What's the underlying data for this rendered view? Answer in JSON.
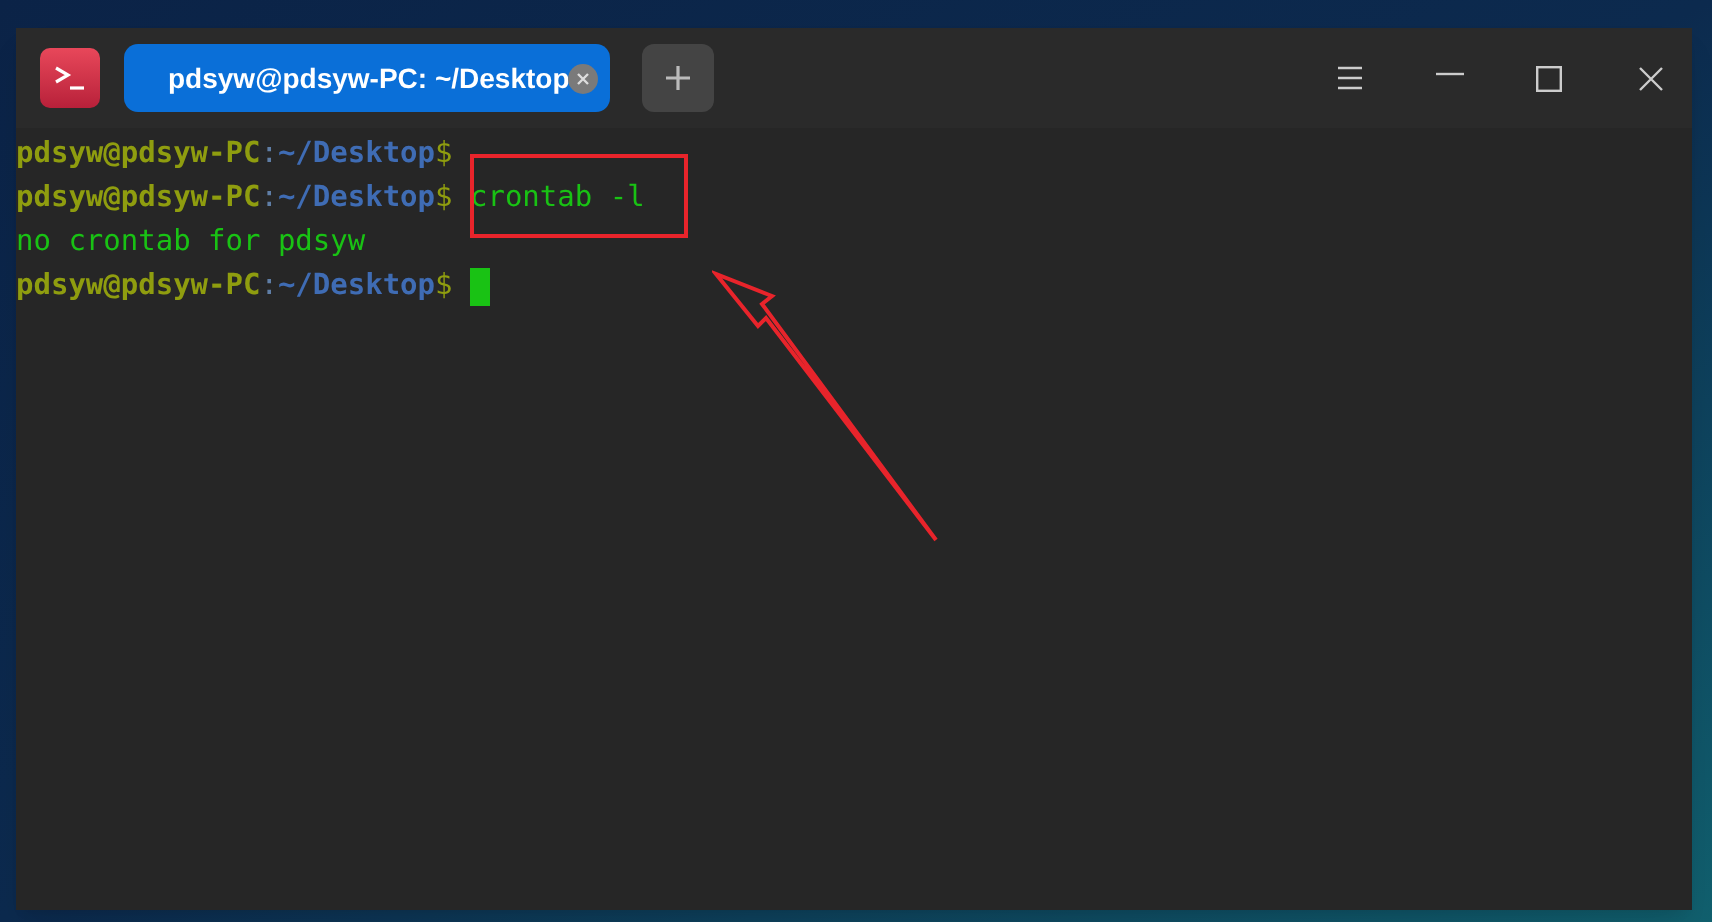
{
  "window": {
    "tabs": [
      {
        "title": "pdsyw@pdsyw-PC: ~/Desktop",
        "selected": true
      }
    ]
  },
  "terminal": {
    "lines": [
      {
        "segments": [
          {
            "kind": "host",
            "text": "pdsyw@pdsyw-PC"
          },
          {
            "kind": "separator",
            "text": ":"
          },
          {
            "kind": "path",
            "text": "~/Desktop"
          },
          {
            "kind": "prompt",
            "text": "$"
          }
        ],
        "cursor": false
      },
      {
        "segments": [
          {
            "kind": "host",
            "text": "pdsyw@pdsyw-PC"
          },
          {
            "kind": "separator",
            "text": ":"
          },
          {
            "kind": "path",
            "text": "~/Desktop"
          },
          {
            "kind": "prompt",
            "text": "$"
          },
          {
            "kind": "command",
            "text": " crontab -l"
          }
        ],
        "cursor": false
      },
      {
        "segments": [
          {
            "kind": "output",
            "text": "no crontab for pdsyw"
          }
        ],
        "cursor": false
      },
      {
        "segments": [
          {
            "kind": "host",
            "text": "pdsyw@pdsyw-PC"
          },
          {
            "kind": "separator",
            "text": ":"
          },
          {
            "kind": "path",
            "text": "~/Desktop"
          },
          {
            "kind": "prompt",
            "text": "$"
          }
        ],
        "cursor": true
      }
    ]
  }
}
